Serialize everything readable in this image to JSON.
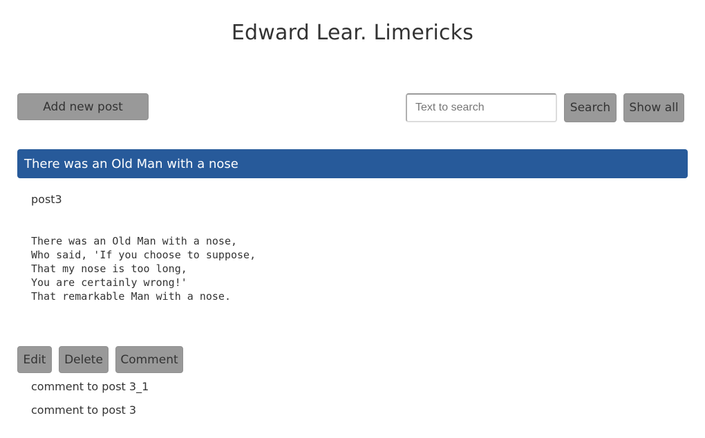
{
  "header": {
    "title": "Edward Lear. Limericks"
  },
  "toolbar": {
    "add_label": "Add new post",
    "search_placeholder": "Text to search",
    "search_value": "",
    "search_label": "Search",
    "show_all_label": "Show all"
  },
  "post": {
    "title": "There was an Old Man with a nose",
    "name": "post3",
    "body": "There was an Old Man with a nose,\nWho said, 'If you choose to suppose,\nThat my nose is too long,\nYou are certainly wrong!'\nThat remarkable Man with a nose.",
    "actions": {
      "edit_label": "Edit",
      "delete_label": "Delete",
      "comment_label": "Comment"
    },
    "comments": [
      {
        "text": "comment to post 3_1"
      },
      {
        "text": "comment to post 3"
      }
    ]
  },
  "colors": {
    "accent": "#275a9a",
    "button": "#999999"
  }
}
